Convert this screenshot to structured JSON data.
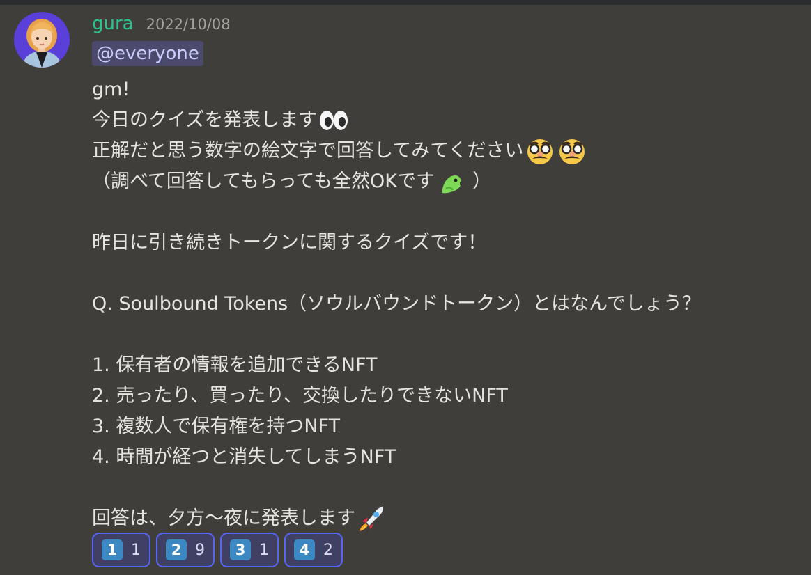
{
  "message": {
    "author": "gura",
    "timestamp": "2022/10/08",
    "mention": "@everyone",
    "lines": [
      {
        "text": "gm!",
        "emojis": []
      },
      {
        "text": "今日のクイズを発表します",
        "emojis": [
          "eyes-emoji"
        ]
      },
      {
        "text": "正解だと思う数字の絵文字で回答してみてください",
        "emojis": [
          "disguised-face-emoji",
          "disguised-face-emoji"
        ]
      },
      {
        "text": "（調べて回答してもらっても全然OKです",
        "emojis": [
          "parrot-emoji"
        ],
        "suffix": "）"
      },
      {
        "text": "",
        "emojis": []
      },
      {
        "text": "昨日に引き続きトークンに関するクイズです！",
        "emojis": []
      },
      {
        "text": "",
        "emojis": []
      },
      {
        "text": "Q. Soulbound Tokens（ソウルバウンドトークン）とはなんでしょう？",
        "emojis": []
      },
      {
        "text": "",
        "emojis": []
      },
      {
        "text": "1.  保有者の情報を追加できるNFT",
        "emojis": []
      },
      {
        "text": "2. 売ったり、買ったり、交換したりできないNFT",
        "emojis": []
      },
      {
        "text": "3. 複数人で保有権を持つNFT",
        "emojis": []
      },
      {
        "text": "4. 時間が経つと消失してしまうNFT",
        "emojis": []
      },
      {
        "text": "",
        "emojis": []
      },
      {
        "text": "回答は、夕方〜夜に発表します",
        "emojis": [
          "rocket-emoji"
        ]
      }
    ]
  },
  "reactions": [
    {
      "emoji": "1",
      "count": "1"
    },
    {
      "emoji": "2",
      "count": "9"
    },
    {
      "emoji": "3",
      "count": "1"
    },
    {
      "emoji": "4",
      "count": "2"
    }
  ],
  "colors": {
    "background": "#403e3a",
    "username": "#2ac48f",
    "mention_bg": "#4c4a6c",
    "reaction_border": "#5865f2",
    "keycap": "#3b88c3"
  }
}
